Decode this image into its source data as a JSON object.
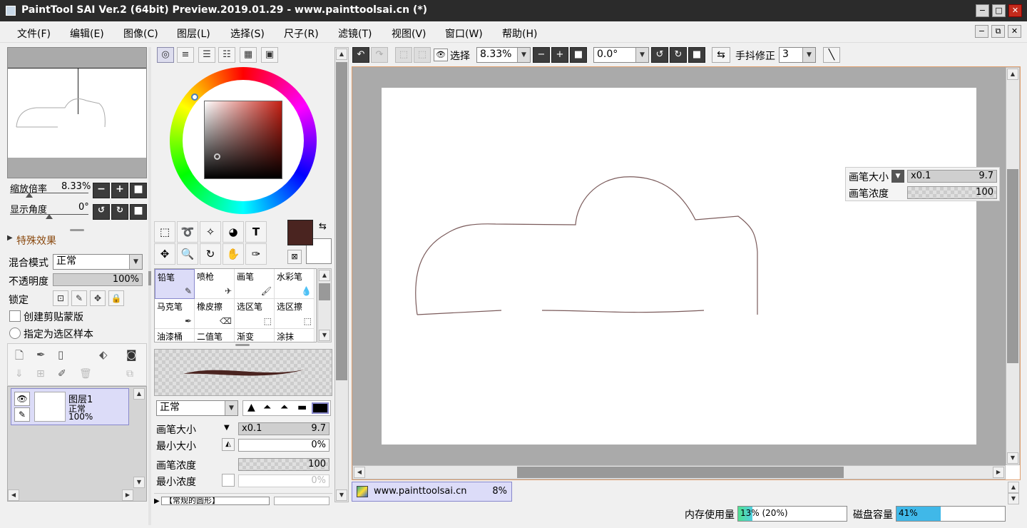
{
  "window": {
    "title": "PaintTool SAI Ver.2 (64bit) Preview.2019.01.29 - www.painttoolsai.cn (*)",
    "minimize": "−",
    "maximize": "□",
    "close": "✕"
  },
  "menu": [
    "文件(F)",
    "编辑(E)",
    "图像(C)",
    "图层(L)",
    "选择(S)",
    "尺子(R)",
    "滤镜(T)",
    "视图(V)",
    "窗口(W)",
    "帮助(H)"
  ],
  "navigator": {
    "zoom_label": "缩放倍率",
    "zoom_value": "8.33%",
    "angle_label": "显示角度",
    "angle_value": "0°"
  },
  "layer_panel": {
    "effects_label": "特殊效果",
    "blend_label": "混合模式",
    "blend_value": "正常",
    "opacity_label": "不透明度",
    "opacity_value": "100%",
    "lock_label": "锁定",
    "clipping_label": "创建剪贴蒙版",
    "sample_label": "指定为选区样本",
    "layer": {
      "name": "图层1",
      "mode": "正常",
      "opacity": "100%"
    }
  },
  "brushes": [
    {
      "name": "铅笔",
      "selected": true
    },
    {
      "name": "喷枪"
    },
    {
      "name": "画笔"
    },
    {
      "name": "水彩笔"
    },
    {
      "name": "马克笔"
    },
    {
      "name": "橡皮擦"
    },
    {
      "name": "选区笔"
    },
    {
      "name": "选区擦"
    },
    {
      "name": "油漆桶"
    },
    {
      "name": "二值笔"
    },
    {
      "name": "渐变"
    },
    {
      "name": "涂抹"
    }
  ],
  "brush_settings": {
    "blend_value": "正常",
    "size_label": "画笔大小",
    "size_mult": "x0.1",
    "size_value": "9.7",
    "min_size_label": "最小大小",
    "min_size_value": "0%",
    "density_label": "画笔浓度",
    "density_value": "100",
    "min_density_label": "最小浓度",
    "min_density_value": "0%",
    "shape_label": "【常规的圆形】"
  },
  "colors": {
    "foreground": "#4a2420",
    "background": "#ffffff"
  },
  "toolbar": {
    "select_label": "选择",
    "zoom_value": "8.33%",
    "angle_value": "0.0°",
    "stabilizer_label": "手抖修正",
    "stabilizer_value": "3"
  },
  "floating": {
    "size_label": "画笔大小",
    "size_mult": "x0.1",
    "size_value": "9.7",
    "density_label": "画笔浓度",
    "density_value": "100"
  },
  "document_tab": {
    "name": "www.painttoolsai.cn",
    "zoom": "8%"
  },
  "status": {
    "memory_label": "内存使用量",
    "memory_value": "13% (20%)",
    "memory_fraction": 0.13,
    "disk_label": "磁盘容量",
    "disk_value": "41%",
    "disk_fraction": 0.41
  }
}
